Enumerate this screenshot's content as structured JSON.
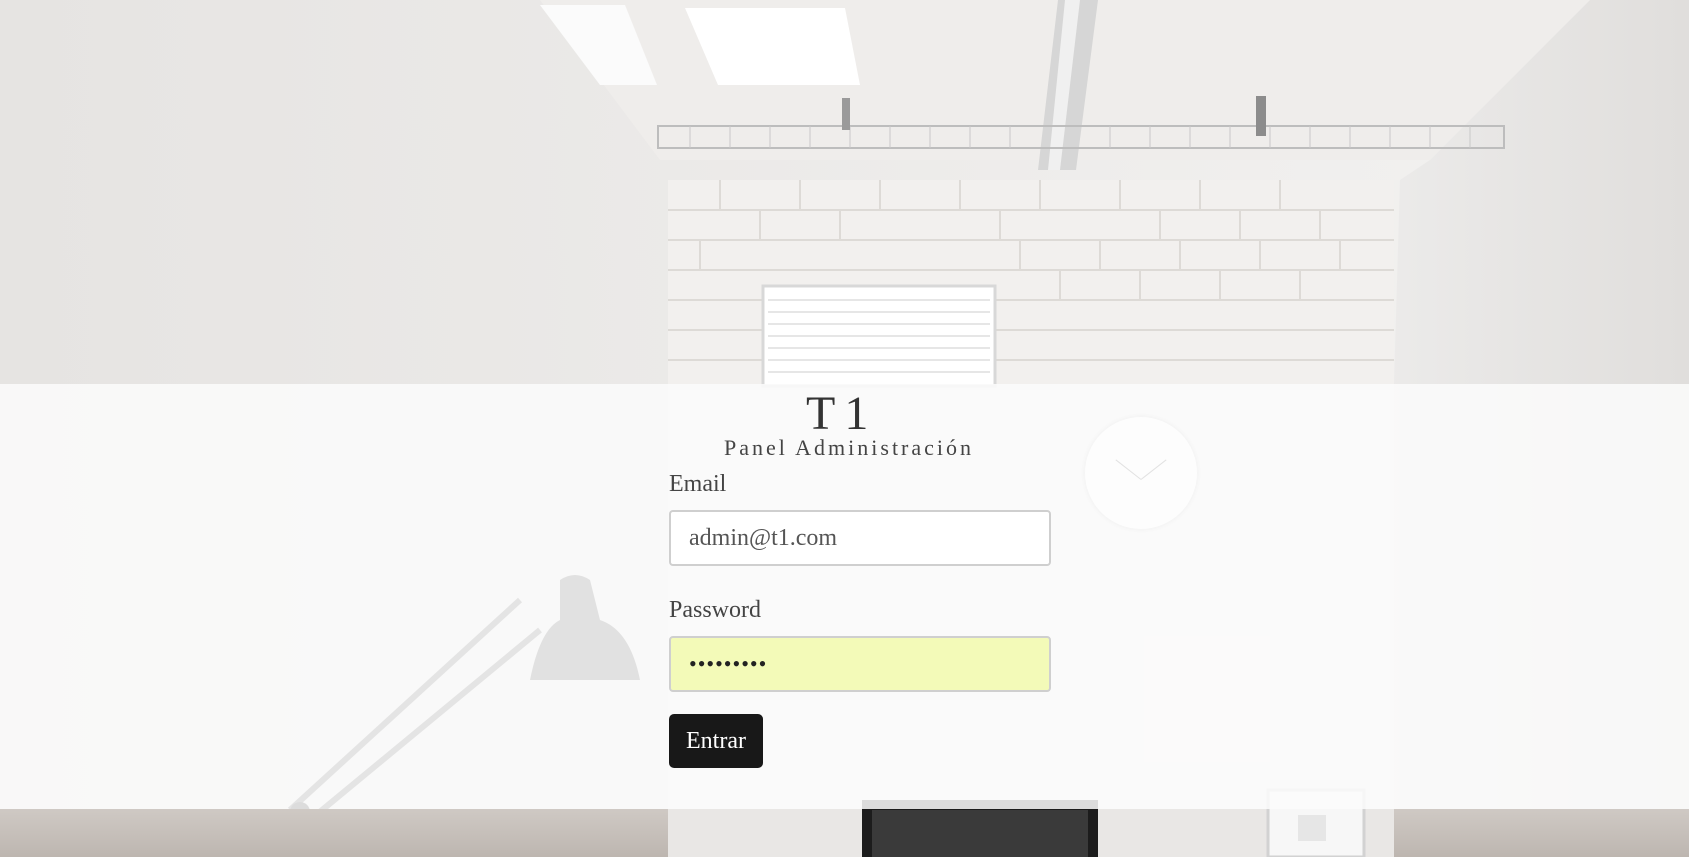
{
  "header": {
    "title": "T1",
    "subtitle": "Panel Administración"
  },
  "form": {
    "email_label": "Email",
    "email_value": "admin@t1.com",
    "password_label": "Password",
    "password_value": "•••••••••",
    "submit_label": "Entrar"
  },
  "colors": {
    "button_bg": "#181818",
    "autofill_bg": "#f3fab8"
  }
}
